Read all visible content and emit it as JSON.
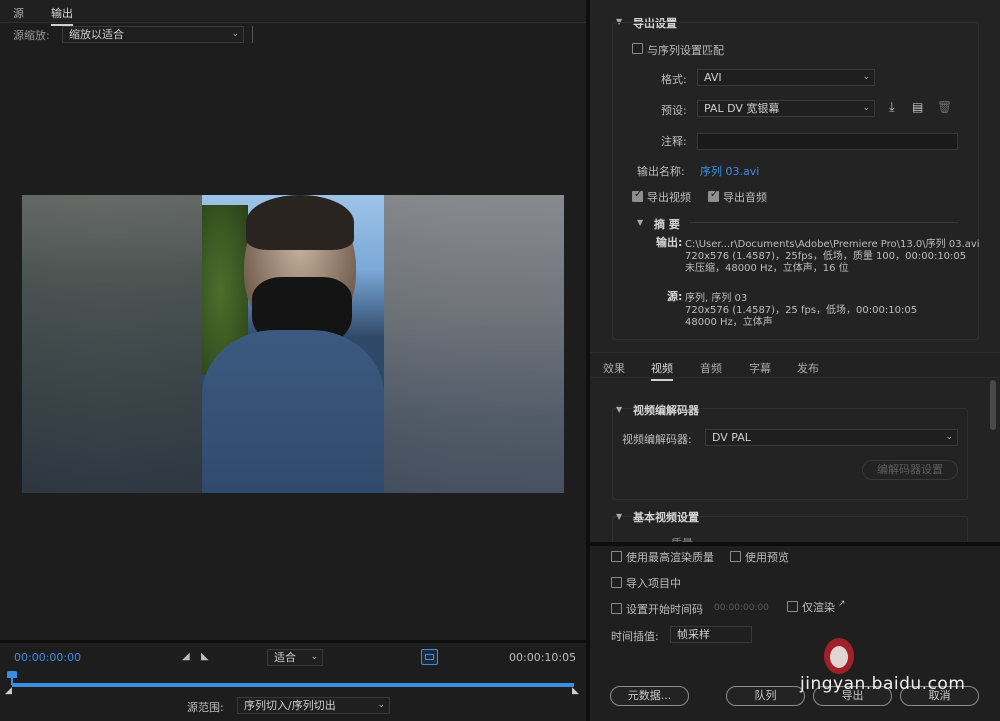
{
  "source_panel": {
    "tabs": [
      "源",
      "输出"
    ],
    "active_tab": 1,
    "source_scale_label": "源缩放:",
    "source_scale_value": "缩放以适合",
    "timecode_start": "00:00:00:00",
    "timecode_end": "00:00:10:05",
    "fit_value": "适合",
    "source_range_label": "源范围:",
    "source_range_value": "序列切入/序列切出"
  },
  "export_settings": {
    "title": "导出设置",
    "match_sequence_label": "与序列设置匹配",
    "format_label": "格式:",
    "format_value": "AVI",
    "preset_label": "预设:",
    "preset_value": "PAL DV 宽银幕",
    "comments_label": "注释:",
    "comments_value": "",
    "output_name_label": "输出名称:",
    "output_name_value": "序列 03.avi",
    "export_video_label": "导出视频",
    "export_audio_label": "导出音频",
    "summary": {
      "title": "摘 要",
      "output_label": "输出:",
      "output_line1": "C:\\User...r\\Documents\\Adobe\\Premiere Pro\\13.0\\序列 03.avi",
      "output_line2": "720x576 (1.4587)，25fps，低场，质量 100，00:00:10:05",
      "output_line3": "未压缩，48000 Hz，立体声，16 位",
      "source_label": "源:",
      "source_line1": "序列, 序列 03",
      "source_line2": "720x576 (1.4587)，25 fps，低场，00:00:10:05",
      "source_line3": "48000 Hz，立体声"
    }
  },
  "settings_tabs": [
    "效果",
    "视频",
    "音频",
    "字幕",
    "发布"
  ],
  "settings_active_tab": 1,
  "video_codec": {
    "title": "视频编解码器",
    "codec_label": "视频编解码器:",
    "codec_value": "DV PAL",
    "codec_settings_button": "编解码器设置"
  },
  "basic_video": {
    "title": "基本视频设置",
    "partial_label": "质量"
  },
  "bottom_options": {
    "max_render_quality": "使用最高渲染质量",
    "use_previews": "使用预览",
    "import_into_project": "导入项目中",
    "set_start_timecode": "设置开始时间码",
    "start_timecode_value": "00:00:00:00",
    "render_alpha_only": "仅渲染",
    "time_interpolation_label": "时间插值:",
    "time_interpolation_value": "帧采样",
    "metadata_button": "元数据...",
    "queue_button": "队列",
    "export_button": "导出",
    "cancel_button": "取消"
  },
  "watermark": {
    "text": "jingyan.baidu.com"
  },
  "colors": {
    "accent_blue": "#3a8ee6",
    "panel_bg": "#232323",
    "divider": "#0f0f0f"
  }
}
